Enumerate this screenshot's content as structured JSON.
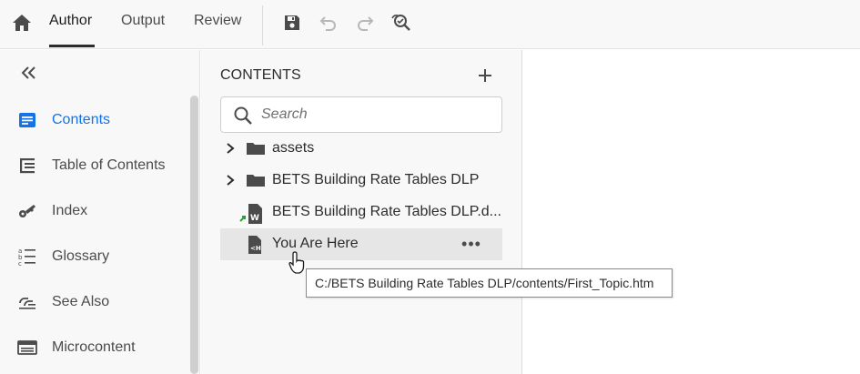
{
  "topbar": {
    "tabs": [
      {
        "label": "Author",
        "active": true
      },
      {
        "label": "Output",
        "active": false
      },
      {
        "label": "Review",
        "active": false
      }
    ],
    "tools": [
      "save-icon",
      "undo-icon",
      "redo-icon",
      "search-replace-icon"
    ]
  },
  "sidebar": {
    "items": [
      {
        "label": "Contents",
        "icon": "contents-icon",
        "active": true
      },
      {
        "label": "Table of Contents",
        "icon": "toc-icon",
        "active": false
      },
      {
        "label": "Index",
        "icon": "key-icon",
        "active": false
      },
      {
        "label": "Glossary",
        "icon": "glossary-icon",
        "active": false
      },
      {
        "label": "See Also",
        "icon": "see-also-icon",
        "active": false
      },
      {
        "label": "Microcontent",
        "icon": "microcontent-icon",
        "active": false
      }
    ]
  },
  "contents": {
    "title": "CONTENTS",
    "search_placeholder": "Search",
    "tree": [
      {
        "label": "assets",
        "type": "folder",
        "expandable": true
      },
      {
        "label": "BETS Building Rate Tables DLP",
        "type": "folder",
        "expandable": true
      },
      {
        "label": "BETS Building Rate Tables DLP.d...",
        "type": "word-doc-link",
        "expandable": false
      },
      {
        "label": "You Are Here",
        "type": "topic",
        "expandable": false,
        "selected": true
      }
    ]
  },
  "tooltip": {
    "text": "C:/BETS Building Rate Tables DLP/contents/First_Topic.htm"
  },
  "colors": {
    "accent": "#1473e6",
    "toolbar_bg": "#f8f8f8",
    "selected_row": "#e6e6e6",
    "link_arrow": "#2d9d3a"
  }
}
